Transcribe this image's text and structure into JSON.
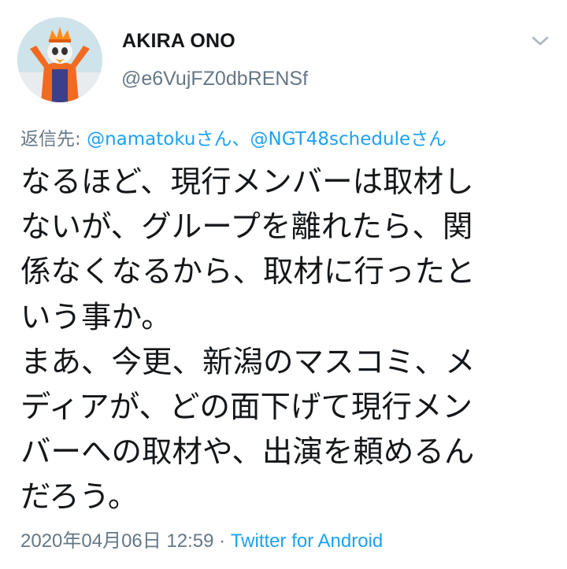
{
  "author": {
    "display_name": "AKIRA ONO",
    "handle": "@e6VujFZ0dbRENSf",
    "avatar_icon": "mascot-avatar"
  },
  "reply": {
    "prefix": "返信先: ",
    "mention1": "@namatoku",
    "suffix1": "さん、",
    "mention2": "@NGT48schedule",
    "suffix2": "さん"
  },
  "tweet_lines": [
    "なるほど、現行メンバーは取材し",
    "ないが、グループを離れたら、関",
    "係なくなるから、取材に行ったと",
    "いう事か。",
    "まあ、今更、新潟のマスコミ、メ",
    "ディアが、どの面下げて現行メン",
    "バーへの取材や、出演を頼めるん",
    "だろう。"
  ],
  "meta": {
    "datetime": "2020年04月06日 12:59",
    "separator": " · ",
    "source": "Twitter for Android"
  },
  "icons": {
    "menu": "chevron-down-icon"
  },
  "colors": {
    "link": "#1da1f2",
    "secondary_text": "#657786",
    "text": "#14171a"
  }
}
